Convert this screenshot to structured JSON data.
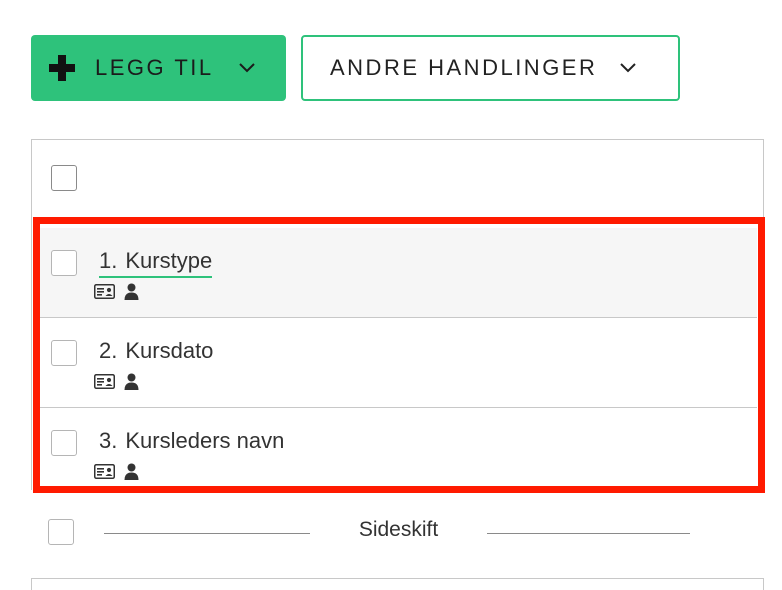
{
  "toolbar": {
    "add_label": "LEGG TIL",
    "other_actions_label": "ANDRE HANDLINGER",
    "accent_color": "#2ec27b",
    "icons": {
      "add": "plus-icon",
      "dropdown": "chevron-down-icon"
    }
  },
  "list": {
    "items": [
      {
        "number": "1.",
        "label": "Kurstype",
        "icons": [
          "id-card-icon",
          "user-icon"
        ],
        "hovered": true
      },
      {
        "number": "2.",
        "label": "Kursdato",
        "icons": [
          "id-card-icon",
          "user-icon"
        ]
      },
      {
        "number": "3.",
        "label": "Kursleders navn",
        "icons": [
          "id-card-icon",
          "user-icon"
        ]
      }
    ],
    "highlight_color": "#ff1a00"
  },
  "page_break": {
    "label": "Sideskift"
  }
}
